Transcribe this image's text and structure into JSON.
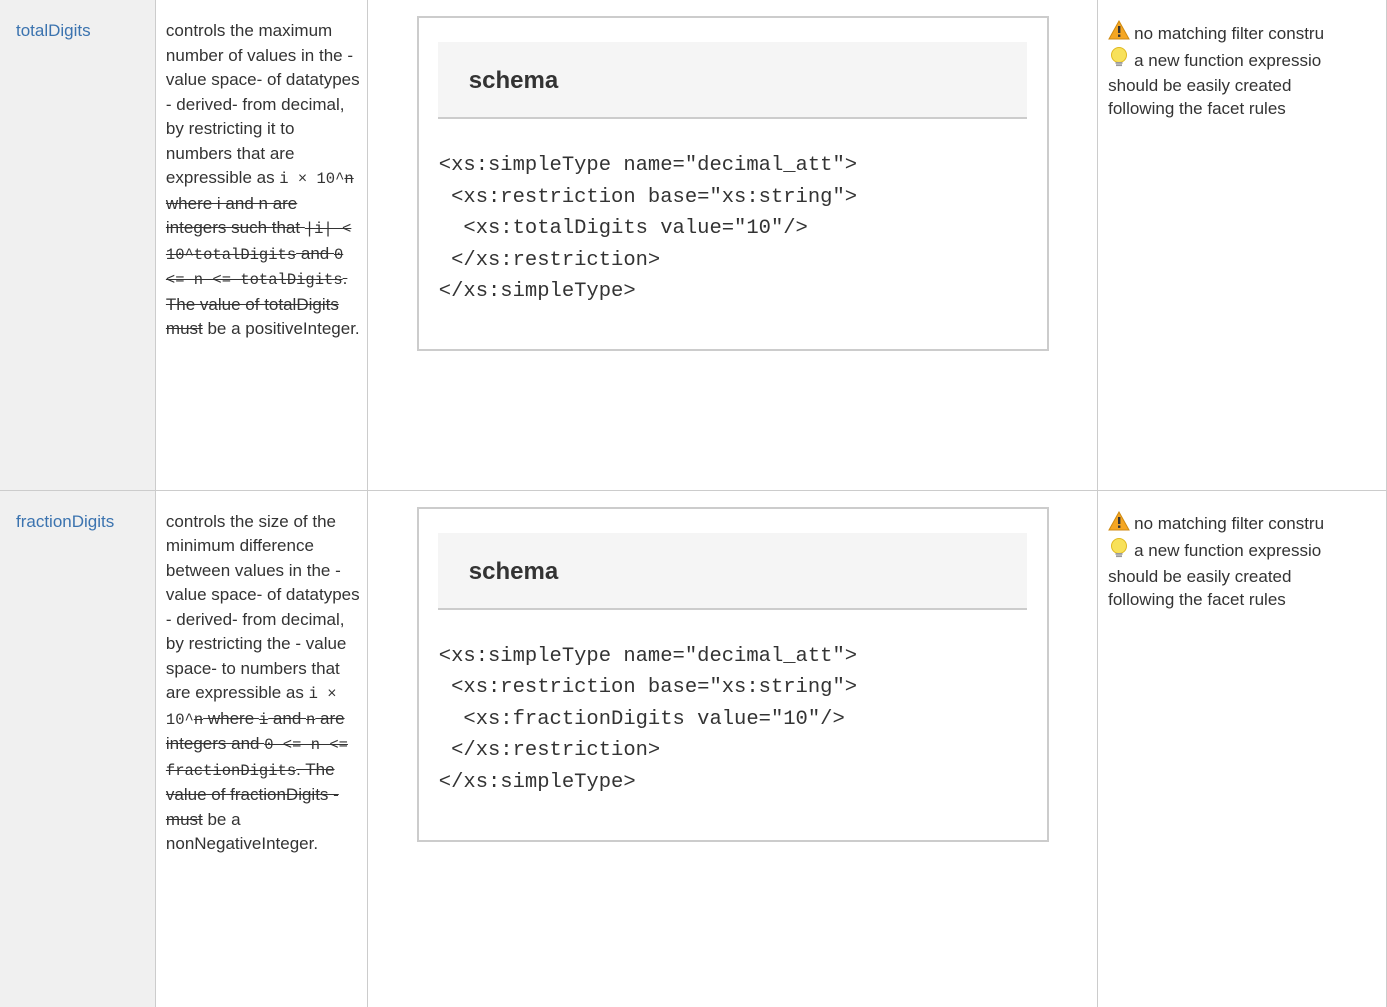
{
  "rows": [
    {
      "facet": "totalDigits",
      "desc": {
        "lead": "controls the maximum number of values in the - value space- of datatypes - derived- from decimal, by restricting it to numbers that are expressible as ",
        "expr1": "i × 10^",
        "struck_n": "n",
        "s1": " where i and n are integers such that ",
        "c1": "|i| < 10^totalDigits",
        "s2": " and ",
        "c2": "0 <= n <= totalDigits",
        "s3": ". The value of totalDigits must",
        "tail": " be a positiveInteger."
      },
      "code": {
        "title": "schema",
        "lines": [
          "<xs:simpleType name=\"decimal_att\">",
          " <xs:restriction base=\"xs:string\">",
          "  <xs:totalDigits value=\"10\"/>",
          " </xs:restriction>",
          "</xs:simpleType>"
        ]
      },
      "notes": {
        "warning": "no matching filter constru",
        "idea": "a new function expressio",
        "line3": "should be easily created",
        "line4": "following the facet rules"
      }
    },
    {
      "facet": "fractionDigits",
      "desc": {
        "lead": "controls the size of the minimum difference between values in the - value space- of datatypes - derived- from decimal, by restricting the - value space- to numbers that are expressible as ",
        "expr1": "i × 10^",
        "struck_n": "n",
        "s1a": " where ",
        "c_i": "i",
        "s1b": " and ",
        "c_n": "n",
        "s1c": " are integers and ",
        "c2": "0 <= n <= fractionDigits",
        "s3": ". The value of fractionDigits - must",
        "tail": " be a nonNegativeInteger."
      },
      "code": {
        "title": "schema",
        "lines": [
          "<xs:simpleType name=\"decimal_att\">",
          " <xs:restriction base=\"xs:string\">",
          "  <xs:fractionDigits value=\"10\"/>",
          " </xs:restriction>",
          "</xs:simpleType>"
        ]
      },
      "notes": {
        "warning": "no matching filter constru",
        "idea": "a new function expressio",
        "line3": "should be easily created",
        "line4": "following the facet rules"
      }
    }
  ]
}
